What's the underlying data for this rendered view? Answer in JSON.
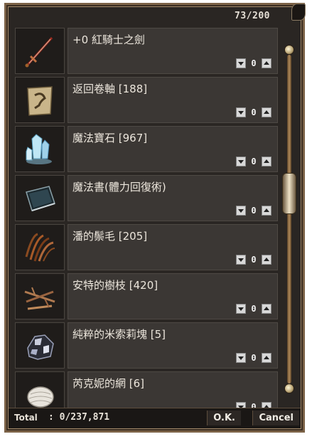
{
  "capacity": "73/200",
  "items": [
    {
      "name": "+0 紅騎士之劍",
      "qty": "0",
      "icon": "red-knight-sword-icon"
    },
    {
      "name": "返回卷軸 [188]",
      "qty": "0",
      "icon": "return-scroll-icon"
    },
    {
      "name": "魔法寶石 [967]",
      "qty": "0",
      "icon": "magic-gem-icon"
    },
    {
      "name": "魔法書(體力回復術)",
      "qty": "0",
      "icon": "spellbook-icon"
    },
    {
      "name": "潘的鬃毛 [205]",
      "qty": "0",
      "icon": "pan-mane-icon"
    },
    {
      "name": "安特的樹枝 [420]",
      "qty": "0",
      "icon": "ent-branch-icon"
    },
    {
      "name": "純粹的米索莉塊 [5]",
      "qty": "0",
      "icon": "mithril-ore-icon"
    },
    {
      "name": "芮克妮的網 [6]",
      "qty": "0",
      "icon": "arachne-web-icon"
    }
  ],
  "footer": {
    "total_label": "Total",
    "total_value": ": 0/237,871",
    "ok_label": "O.K.",
    "cancel_label": "Cancel"
  }
}
